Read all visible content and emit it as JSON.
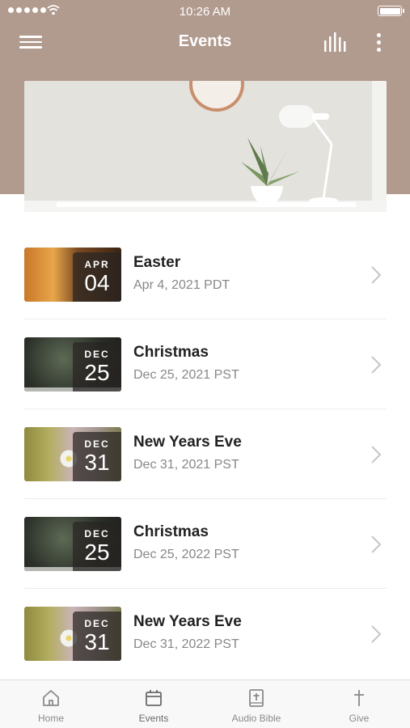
{
  "status_bar": {
    "time": "10:26 AM"
  },
  "nav": {
    "title": "Events"
  },
  "events": [
    {
      "month": "APR",
      "day": "04",
      "name": "Easter",
      "date": "Apr 4, 2021 PDT"
    },
    {
      "month": "DEC",
      "day": "25",
      "name": "Christmas",
      "date": "Dec 25, 2021 PST"
    },
    {
      "month": "DEC",
      "day": "31",
      "name": "New Years Eve",
      "date": "Dec 31, 2021 PST"
    },
    {
      "month": "DEC",
      "day": "25",
      "name": "Christmas",
      "date": "Dec 25, 2022 PST"
    },
    {
      "month": "DEC",
      "day": "31",
      "name": "New Years Eve",
      "date": "Dec 31, 2022 PST"
    }
  ],
  "tabs": [
    {
      "label": "Home",
      "icon": "home-icon"
    },
    {
      "label": "Events",
      "icon": "calendar-icon"
    },
    {
      "label": "Audio Bible",
      "icon": "bible-icon"
    },
    {
      "label": "Give",
      "icon": "cross-icon"
    }
  ],
  "colors": {
    "header": "#b19a8e",
    "tab_bar": "#f8f8f8",
    "text_primary": "#222222",
    "text_secondary": "#888888"
  }
}
